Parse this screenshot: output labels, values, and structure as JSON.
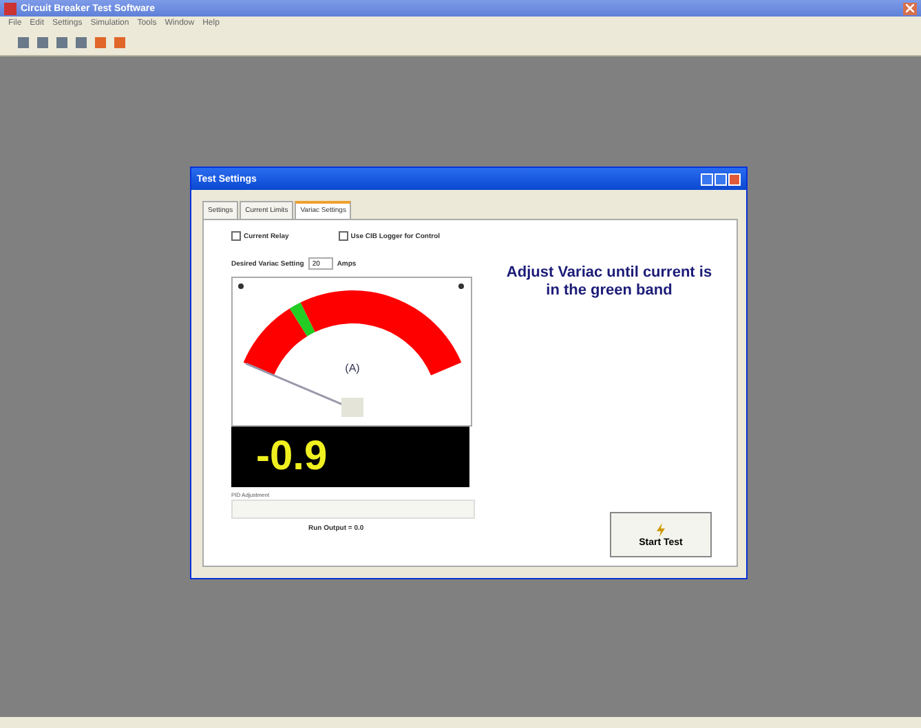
{
  "window": {
    "title": "Circuit Breaker Test Software"
  },
  "menu": [
    "File",
    "Edit",
    "Settings",
    "Simulation",
    "Tools",
    "Window",
    "Help"
  ],
  "dialog": {
    "title": "Test Settings",
    "tabs": [
      {
        "label": "Settings",
        "selected": false
      },
      {
        "label": "Current Limits",
        "selected": false
      },
      {
        "label": "Variac Settings",
        "selected": true
      }
    ],
    "checkboxes": [
      {
        "label": "Current Relay",
        "checked": false
      },
      {
        "label": "Use CIB Logger for Control",
        "checked": false
      }
    ],
    "variac": {
      "label": "Desired Variac Setting",
      "value": "20",
      "unit": "Amps"
    },
    "gauge": {
      "unit": "(A)",
      "reading": "-0.9"
    },
    "pid": {
      "label": "PID Adjustment"
    },
    "run_output": "Run Output = 0.0",
    "message": "Adjust Variac until current is in the green band",
    "start_button": "Start Test"
  }
}
